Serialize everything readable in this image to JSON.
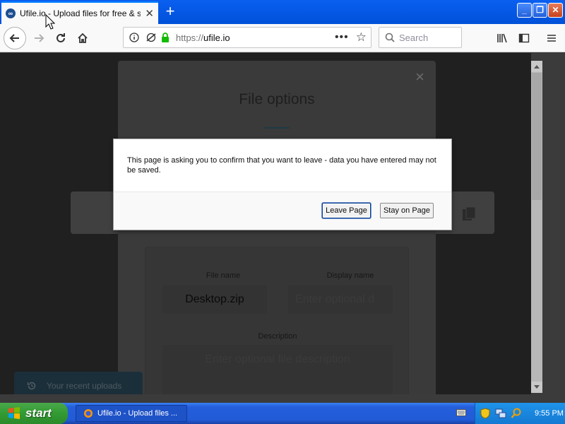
{
  "browser": {
    "tab_title": "Ufile.io - Upload files for free & share",
    "favicon_letters": "∞",
    "url_dim": "https://",
    "url_host": "ufile.io",
    "search_placeholder": "Search"
  },
  "window_controls": {
    "minimize": "_",
    "maximize": "❐",
    "close": "✕"
  },
  "modal": {
    "title": "File options",
    "close_glyph": "×",
    "file_name_label": "File name",
    "file_name_value": "Desktop.zip",
    "display_name_label": "Display name",
    "display_name_placeholder": "Enter optional d",
    "description_label": "Description",
    "description_placeholder": "Enter optional file description"
  },
  "recent_uploads": {
    "label": "Your recent uploads"
  },
  "dialog": {
    "message": "This page is asking you to confirm that you want to leave - data you have entered may not be saved.",
    "leave_label": "Leave Page",
    "stay_label": "Stay on Page"
  },
  "taskbar": {
    "start_label": "start",
    "task_label": "Ufile.io - Upload files ...",
    "clock": "9:55 PM"
  },
  "colors": {
    "accent": "#0a84ff",
    "xp_blue": "#245edb",
    "start_green": "#339b33"
  }
}
